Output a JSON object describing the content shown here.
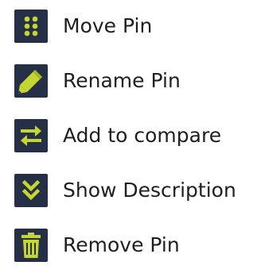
{
  "colors": {
    "icon_bg": "#253047",
    "icon_fg": "#c6d630",
    "text": "#1f1f1f"
  },
  "menu": {
    "items": [
      {
        "label": "Move Pin",
        "icon": "move-grip-icon"
      },
      {
        "label": "Rename Pin",
        "icon": "pencil-icon"
      },
      {
        "label": "Add to compare",
        "icon": "swap-arrows-icon"
      },
      {
        "label": "Show Description",
        "icon": "double-chevron-down-icon"
      },
      {
        "label": "Remove Pin",
        "icon": "trash-icon"
      }
    ]
  }
}
